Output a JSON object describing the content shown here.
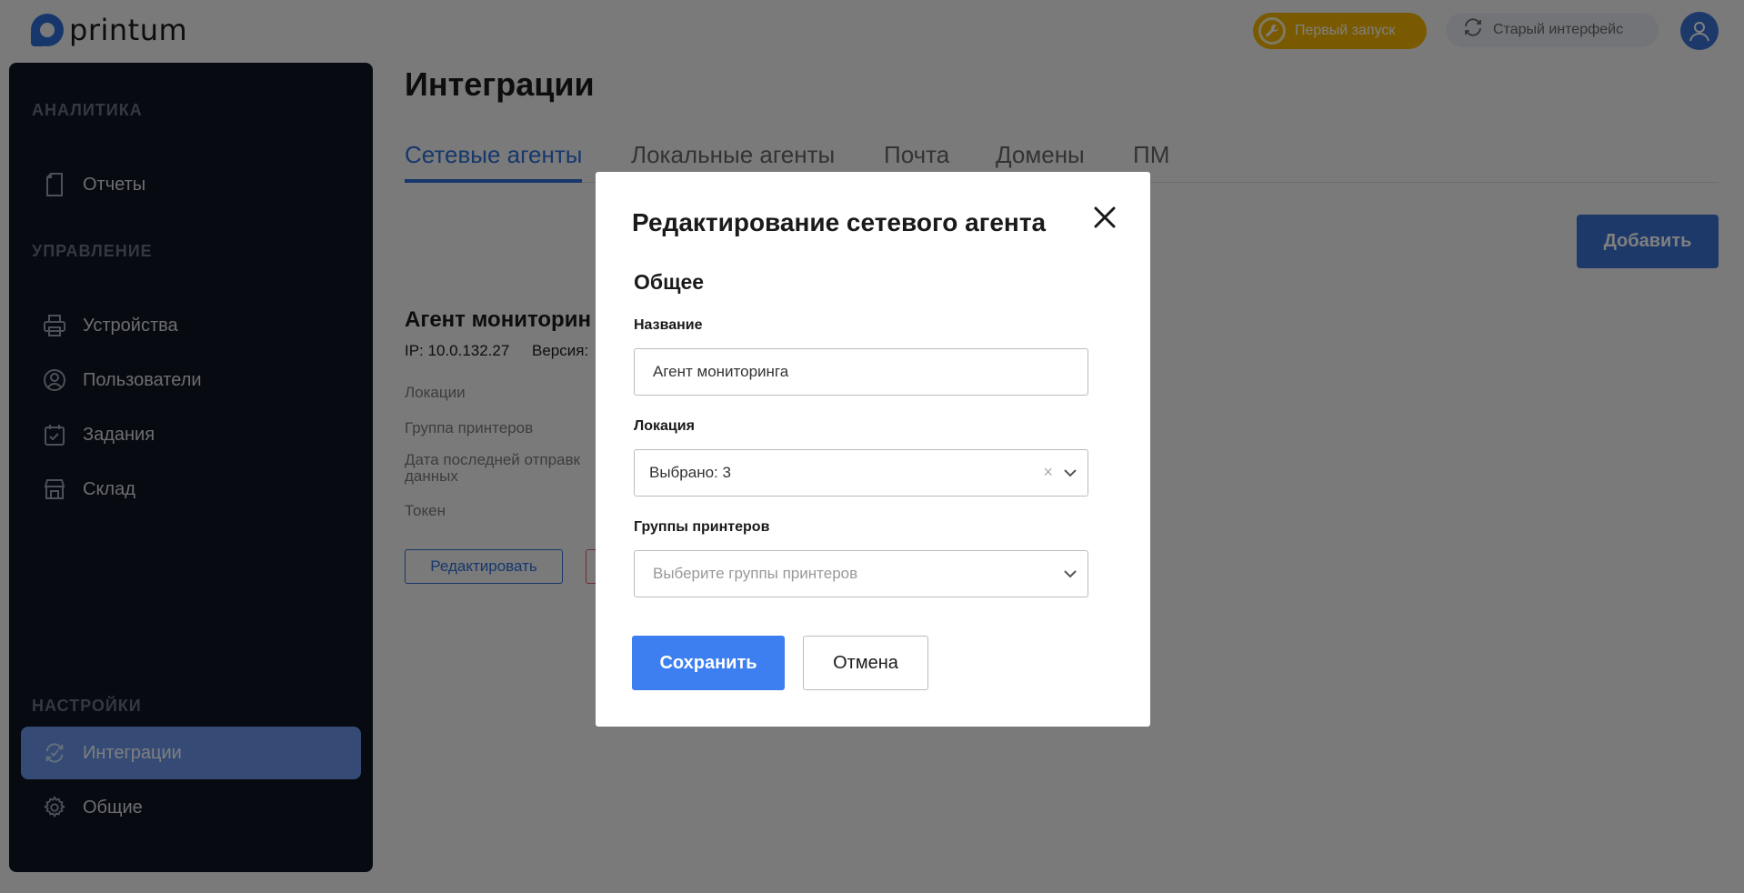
{
  "header": {
    "brand": "printum",
    "first_run_label": "Первый запуск",
    "old_ui_label": "Старый интерфейс"
  },
  "sidebar": {
    "sections": [
      {
        "title": "АНАЛИТИКА",
        "items": [
          {
            "label": "Отчеты",
            "icon": "document-icon"
          }
        ]
      },
      {
        "title": "УПРАВЛЕНИЕ",
        "items": [
          {
            "label": "Устройства",
            "icon": "printer-icon"
          },
          {
            "label": "Пользователи",
            "icon": "user-icon"
          },
          {
            "label": "Задания",
            "icon": "calendar-check-icon"
          },
          {
            "label": "Склад",
            "icon": "store-icon"
          }
        ]
      },
      {
        "title": "НАСТРОЙКИ",
        "items": [
          {
            "label": "Интеграции",
            "icon": "sync-icon",
            "active": true
          },
          {
            "label": "Общие",
            "icon": "gear-icon"
          }
        ]
      }
    ]
  },
  "main": {
    "title": "Интеграции",
    "tabs": [
      {
        "label": "Сетевые агенты",
        "active": true
      },
      {
        "label": "Локальные агенты"
      },
      {
        "label": "Почта"
      },
      {
        "label": "Домены"
      },
      {
        "label": "ПМ"
      }
    ],
    "add_label": "Добавить",
    "agent": {
      "title": "Агент мониторин",
      "ip": "IP: 10.0.132.27",
      "version": "Версия:",
      "props": [
        "Локации",
        "Группа принтеров",
        "Дата последней отправк данных",
        "Токен"
      ],
      "edit_label": "Редактировать"
    }
  },
  "modal": {
    "title": "Редактирование сетевого агента",
    "section": "Общее",
    "name_label": "Название",
    "name_value": "Агент мониторинга",
    "location_label": "Локация",
    "location_value": "Выбрано: 3",
    "groups_label": "Группы принтеров",
    "groups_placeholder": "Выберите группы принтеров",
    "save_label": "Сохранить",
    "cancel_label": "Отмена"
  },
  "colors": {
    "primary": "#3d7ff0",
    "first_run": "#f4b400",
    "sidebar_bg": "#0f1420",
    "active_nav": "#6a97ea"
  }
}
